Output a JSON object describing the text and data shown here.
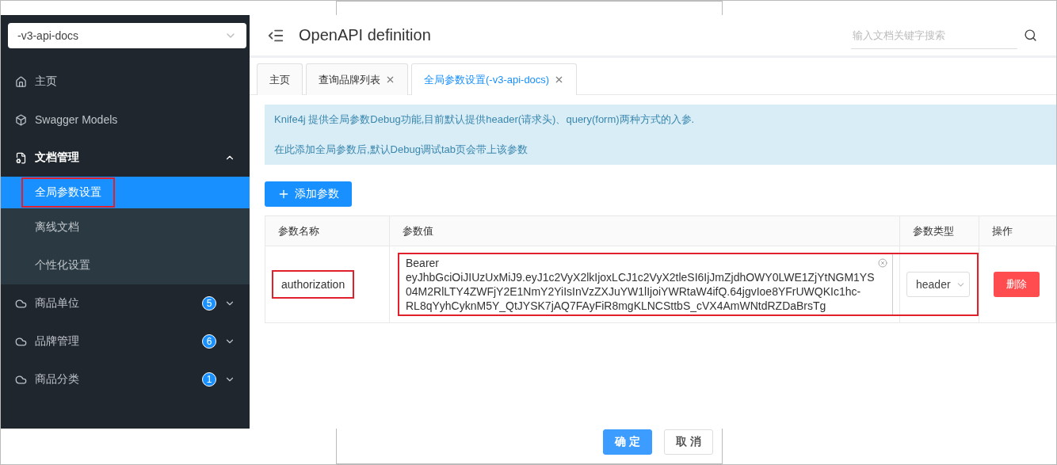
{
  "sidebar": {
    "project_select": {
      "value": "-v3-api-docs"
    },
    "items": [
      {
        "label": "主页"
      },
      {
        "label": "Swagger Models"
      },
      {
        "label": "文档管理",
        "expanded": true,
        "children": [
          {
            "label": "全局参数设置",
            "selected": true,
            "highlighted": true
          },
          {
            "label": "离线文档",
            "selected": false,
            "highlighted": false
          },
          {
            "label": "个性化设置",
            "selected": false,
            "highlighted": false
          }
        ]
      },
      {
        "label": "商品单位",
        "badge": "5"
      },
      {
        "label": "品牌管理",
        "badge": "6"
      },
      {
        "label": "商品分类",
        "badge": "1"
      }
    ]
  },
  "header": {
    "title": "OpenAPI definition",
    "search": {
      "placeholder": "输入文档关键字搜索"
    }
  },
  "tabs": [
    {
      "label": "主页",
      "selected": false,
      "closable": false
    },
    {
      "label": "查询品牌列表",
      "selected": false,
      "closable": true
    },
    {
      "label": "全局参数设置(-v3-api-docs)",
      "selected": true,
      "closable": true
    }
  ],
  "notice": [
    "Knife4j 提供全局参数Debug功能,目前默认提供header(请求头)、query(form)两种方式的入参.",
    "在此添加全局参数后,默认Debug调试tab页会带上该参数"
  ],
  "add_button": "添加参数",
  "table": {
    "columns": [
      "参数名称",
      "参数值",
      "参数类型",
      "操作"
    ],
    "rows": [
      {
        "name": "authorization",
        "value": "Bearer eyJhbGciOiJIUzUxMiJ9.eyJ1c2VyX2lkIjoxLCJ1c2VyX2tleSI6IjJmZjdhOWY0LWE1ZjYtNGM1YS04M2RlLTY4ZWFjY2E1NmY2YiIsInVzZXJuYW1lIjoiYWRtaW4ifQ.64jgvIoe8YFrUWQKIc1hc-RL8qYyhCyknM5Y_QtJYSK7jAQ7FAyFiR8mgKLNCSttbS_cVX4AmWNtdRZDaBrsTg",
        "type": "header",
        "action": "删除",
        "name_highlighted": true,
        "value_highlighted": true
      }
    ]
  },
  "dialog_buttons": [
    {
      "label": "确 定",
      "kind": "primary"
    },
    {
      "label": "取 消",
      "kind": "default"
    }
  ]
}
